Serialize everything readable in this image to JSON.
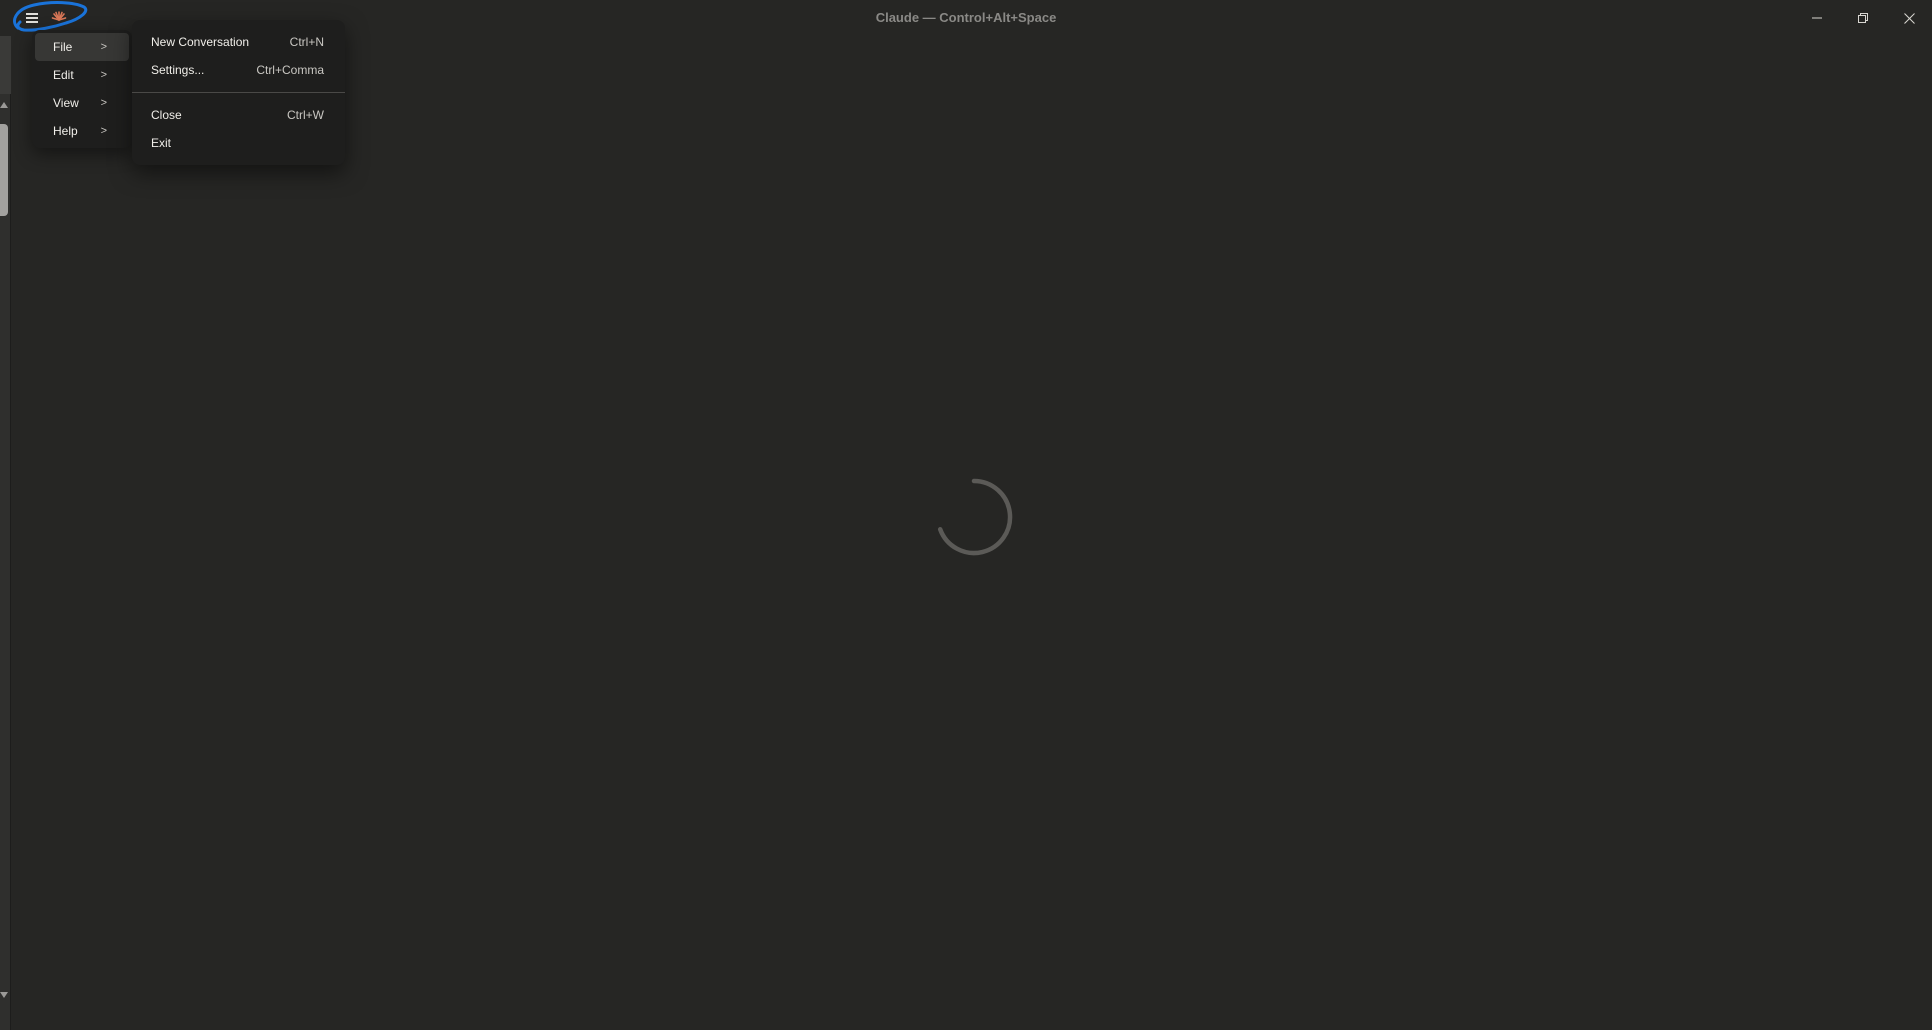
{
  "window": {
    "title": "Claude — Control+Alt+Space"
  },
  "icons": {
    "menu": "hamburger-menu-icon",
    "logo": "claude-logo-icon",
    "minimize": "minimize-icon",
    "maximize": "restore-icon",
    "close": "close-icon",
    "loading": "loading-spinner-icon"
  },
  "colors": {
    "background": "#262624",
    "menu_background": "#1e1e1d",
    "menu_hover": "#373735",
    "accent_logo": "#d97757",
    "annotation": "#1a73d9"
  },
  "main_menu": {
    "items": [
      {
        "label": "File",
        "active": true
      },
      {
        "label": "Edit",
        "active": false
      },
      {
        "label": "View",
        "active": false
      },
      {
        "label": "Help",
        "active": false
      }
    ]
  },
  "file_menu": {
    "items": [
      {
        "label": "New Conversation",
        "shortcut": "Ctrl+N"
      },
      {
        "label": "Settings...",
        "shortcut": "Ctrl+Comma"
      },
      {
        "label": "Close",
        "shortcut": "Ctrl+W"
      },
      {
        "label": "Exit",
        "shortcut": ""
      }
    ]
  }
}
